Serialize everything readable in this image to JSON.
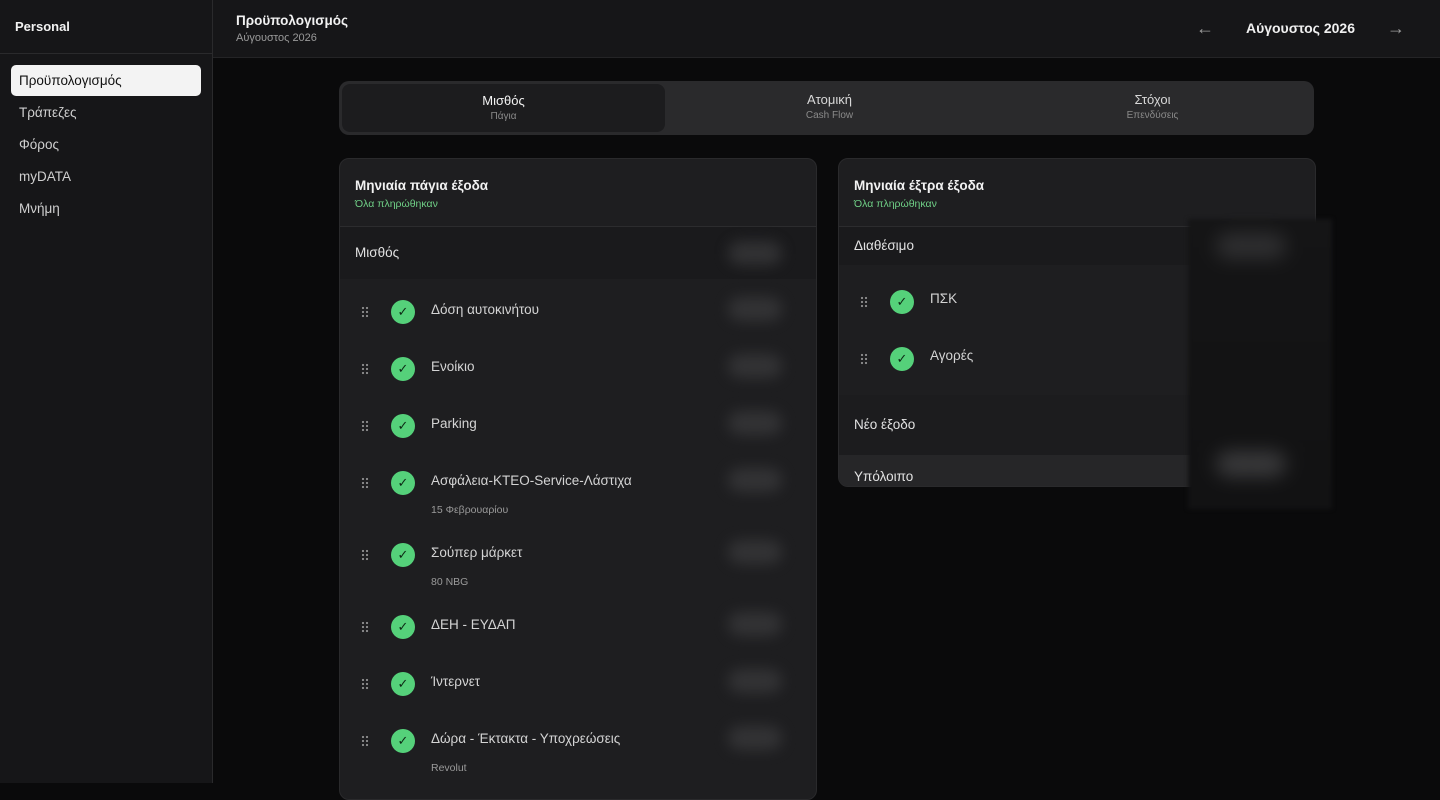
{
  "app": {
    "workspace": "Personal"
  },
  "sidebar": {
    "items": [
      {
        "label": "Προϋπολογισμός",
        "active": true
      },
      {
        "label": "Τράπεζες"
      },
      {
        "label": "Φόρος"
      },
      {
        "label": "myDATA"
      },
      {
        "label": "Μνήμη"
      }
    ]
  },
  "header": {
    "title": "Προϋπολογισμός",
    "subtitle": "Αύγουστος 2026",
    "period": "Αύγουστος 2026",
    "prev_icon": "arrow-left-icon",
    "next_icon": "arrow-right-icon"
  },
  "tabs": [
    {
      "label": "Μισθός",
      "sub": "Πάγια",
      "active": true
    },
    {
      "label": "Ατομική",
      "sub": "Cash Flow"
    },
    {
      "label": "Στόχοι",
      "sub": "Επενδύσεις"
    }
  ],
  "fixed": {
    "title": "Μηνιαία πάγια έξοδα",
    "status": "Όλα πληρώθηκαν",
    "section": "Μισθός",
    "items": [
      {
        "label": "Δόση αυτοκινήτου"
      },
      {
        "label": "Ενοίκιο"
      },
      {
        "label": "Parking"
      },
      {
        "label": "Ασφάλεια-ΚΤΕΟ-Service-Λάστιχα",
        "note": "15 Φεβρουαρίου"
      },
      {
        "label": "Σούπερ μάρκετ",
        "note": "80 NBG"
      },
      {
        "label": "ΔΕΗ - ΕΥΔΑΠ"
      },
      {
        "label": "Ίντερνετ"
      },
      {
        "label": "Δώρα - Έκτακτα - Υποχρεώσεις",
        "note": "Revolut"
      }
    ]
  },
  "extra": {
    "title": "Μηνιαία έξτρα έξοδα",
    "status": "Όλα πληρώθηκαν",
    "section": "Διαθέσιμο",
    "items": [
      {
        "label": "ΠΣΚ"
      },
      {
        "label": "Αγορές"
      }
    ],
    "new_label": "Νέο έξοδο",
    "balance_label": "Υπόλοιπο"
  },
  "colors": {
    "accent_green": "#55d17a",
    "status_green": "#6fcf86",
    "background": "#0a0a0b"
  },
  "check_glyph": "✓"
}
